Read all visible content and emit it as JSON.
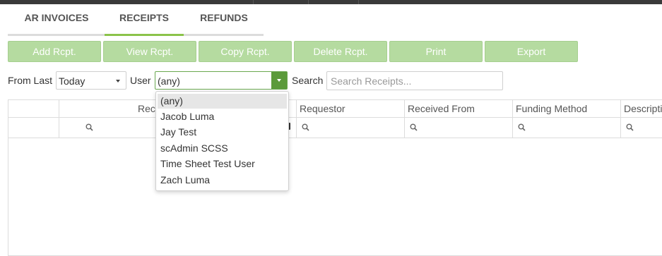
{
  "tabs": [
    {
      "label": "AR INVOICES"
    },
    {
      "label": "RECEIPTS",
      "active": true
    },
    {
      "label": "REFUNDS"
    }
  ],
  "toolbar": {
    "add": "Add Rcpt.",
    "view": "View Rcpt.",
    "copy": "Copy Rcpt.",
    "delete": "Delete Rcpt.",
    "print": "Print",
    "export": "Export"
  },
  "filters": {
    "from_last_label": "From Last",
    "from_last_value": "Today",
    "user_label": "User",
    "user_value": "(any)",
    "search_label": "Search",
    "search_placeholder": "Search Receipts..."
  },
  "grid": {
    "columns": [
      "Rece",
      "Requestor",
      "Received From",
      "Funding Method",
      "Descriptio"
    ]
  },
  "user_dropdown": {
    "options": [
      "(any)",
      "Jacob Luma",
      "Jay Test",
      "scAdmin SCSS",
      "Time Sheet Test User",
      "Zach Luma"
    ],
    "selected": "(any)"
  },
  "colors": {
    "accent": "#8bc34a",
    "button_bg": "#b5dba0",
    "dropdown_button": "#5b9a3a"
  },
  "icons": {
    "filter": "magnifier-icon",
    "date": "calendar-icon"
  }
}
